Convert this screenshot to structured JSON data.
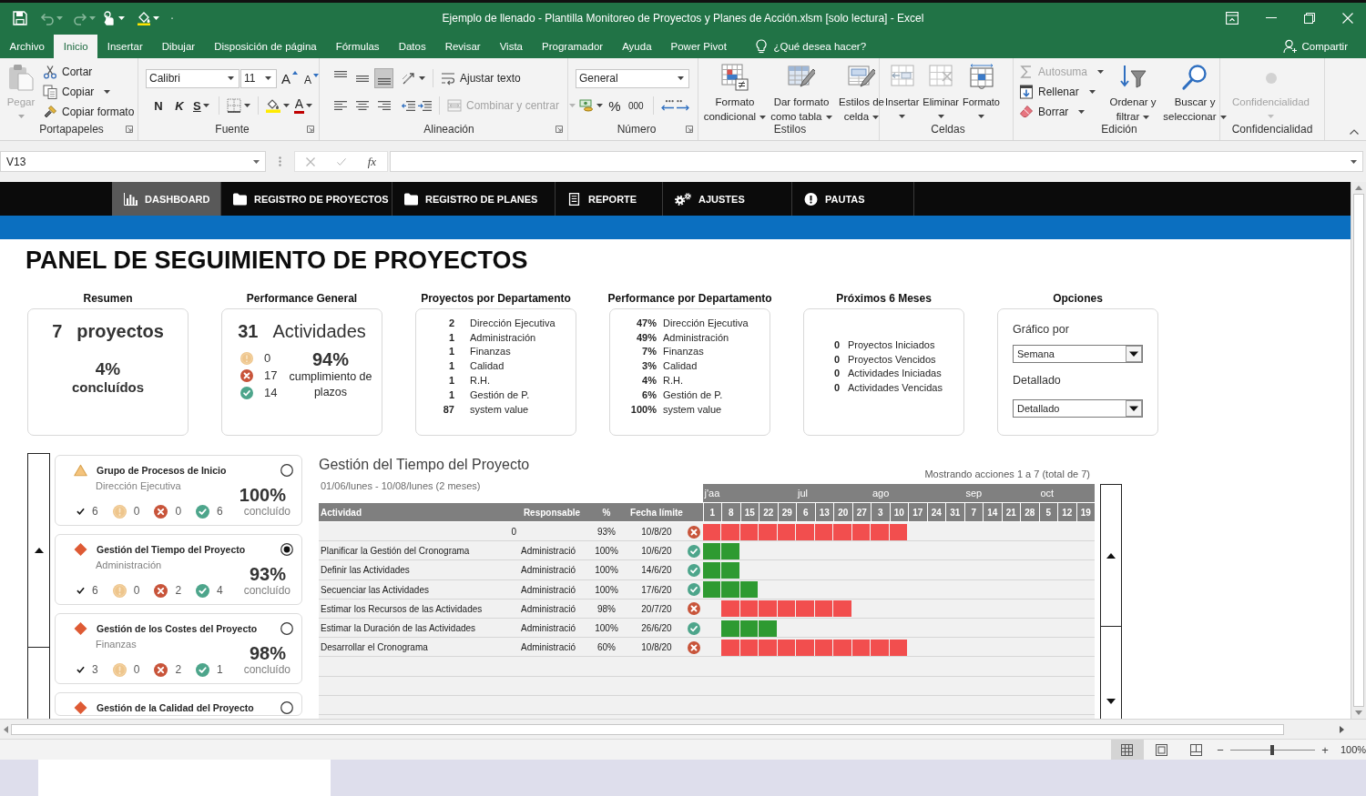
{
  "window": {
    "title": "Ejemplo de llenado - Plantilla Monitoreo de Proyectos y Planes de Acción.xlsm [solo lectura] - Excel"
  },
  "ribbon_tabs": [
    {
      "label": "Archivo",
      "selected": false
    },
    {
      "label": "Inicio",
      "selected": true
    },
    {
      "label": "Insertar",
      "selected": false
    },
    {
      "label": "Dibujar",
      "selected": false
    },
    {
      "label": "Disposición de página",
      "selected": false
    },
    {
      "label": "Fórmulas",
      "selected": false
    },
    {
      "label": "Datos",
      "selected": false
    },
    {
      "label": "Revisar",
      "selected": false
    },
    {
      "label": "Vista",
      "selected": false
    },
    {
      "label": "Programador",
      "selected": false
    },
    {
      "label": "Ayuda",
      "selected": false
    },
    {
      "label": "Power Pivot",
      "selected": false
    }
  ],
  "tell_me": {
    "placeholder": "¿Qué desea hacer?"
  },
  "share": "Compartir",
  "ribbon": {
    "clipboard": {
      "label": "Portapapeles",
      "paste": {
        "label": "Pegar",
        "disabled": true
      },
      "cut": "Cortar",
      "copy": "Copiar",
      "format_painter": "Copiar formato"
    },
    "font": {
      "label": "Fuente",
      "family": "Calibri",
      "size": "11",
      "grow": "A",
      "shrink": "A",
      "bold": "N",
      "italic": "K",
      "underline": "S",
      "font_color": "A"
    },
    "alignment": {
      "label": "Alineación",
      "vertical": [
        {
          "selected": false
        },
        {
          "selected": false
        },
        {
          "selected": true
        }
      ],
      "horizontal": [
        {
          "selected": false
        },
        {
          "selected": false
        },
        {
          "selected": false
        }
      ],
      "wrap": "Ajustar texto",
      "merge": {
        "label": "Combinar y centrar",
        "disabled": true
      }
    },
    "number": {
      "label": "Número",
      "format": "General",
      "percent": "%",
      "thousands": "000"
    },
    "styles": {
      "label": "Estilos",
      "buttons": [
        "Formato condicional",
        "Dar formato como tabla",
        "Estilos de celda"
      ]
    },
    "cells": {
      "label": "Celdas",
      "buttons": [
        "Insertar",
        "Eliminar",
        "Formato"
      ]
    },
    "editing": {
      "label": "Edición",
      "autosum": {
        "label": "Autosuma",
        "disabled": true
      },
      "fill": "Rellenar",
      "clear": "Borrar",
      "sort": "Ordenar y filtrar",
      "find": "Buscar y seleccionar"
    },
    "sensitivity": {
      "label": "Confidencialidad",
      "button": {
        "label": "Confidencialidad",
        "disabled": true
      }
    }
  },
  "formula_bar": {
    "name_box": "V13",
    "function": "fx"
  },
  "nav": [
    {
      "label": "DASHBOARD",
      "selected": true
    },
    {
      "label": "REGISTRO DE PROYECTOS",
      "selected": false
    },
    {
      "label": "REGISTRO DE PLANES",
      "selected": false
    },
    {
      "label": "REPORTE",
      "selected": false
    },
    {
      "label": "AJUSTES",
      "selected": false
    },
    {
      "label": "PAUTAS",
      "selected": false
    }
  ],
  "dashboard": {
    "title": "PANEL DE SEGUIMIENTO DE PROYECTOS",
    "summary": {
      "heading": "Resumen",
      "count": "7",
      "count_label": "proyectos",
      "percent": "4%",
      "percent_label": "concluídos"
    },
    "performance": {
      "heading": "Performance General",
      "count": "31",
      "count_label": "Actividades",
      "statuses": [
        {
          "kind": "pending",
          "value": "0"
        },
        {
          "kind": "overdue",
          "value": "17"
        },
        {
          "kind": "done",
          "value": "14"
        }
      ],
      "percent": "94%",
      "percent_label": "cumplimiento de plazos"
    },
    "projects_by_department": {
      "heading": "Proyectos por Departamento",
      "rows": [
        {
          "count": "2",
          "department": "Dirección Ejecutiva"
        },
        {
          "count": "1",
          "department": "Administración"
        },
        {
          "count": "1",
          "department": "Finanzas"
        },
        {
          "count": "1",
          "department": "Calidad"
        },
        {
          "count": "1",
          "department": "R.H."
        },
        {
          "count": "1",
          "department": "Gestión de P."
        },
        {
          "count": "87",
          "department": "system value"
        }
      ]
    },
    "performance_by_department": {
      "heading": "Performance por Departamento",
      "rows": [
        {
          "percent": "47%",
          "department": "Dirección Ejecutiva"
        },
        {
          "percent": "49%",
          "department": "Administración"
        },
        {
          "percent": "7%",
          "department": "Finanzas"
        },
        {
          "percent": "3%",
          "department": "Calidad"
        },
        {
          "percent": "4%",
          "department": "R.H."
        },
        {
          "percent": "6%",
          "department": "Gestión de P."
        },
        {
          "percent": "100%",
          "department": "system value"
        }
      ]
    },
    "next_months": {
      "heading": "Próximos 6 Meses",
      "rows": [
        {
          "count": "0",
          "metric": "Proyectos Iniciados"
        },
        {
          "count": "0",
          "metric": "Proyectos Vencidos"
        },
        {
          "count": "0",
          "metric": "Actividades Iniciadas"
        },
        {
          "count": "0",
          "metric": "Actividades Vencidas"
        }
      ]
    },
    "options": {
      "heading": "Opciones",
      "fields": [
        {
          "label": "Gráfico por",
          "value": "Semana"
        },
        {
          "label": "Detallado",
          "value": "Detallado"
        }
      ]
    }
  },
  "projects": [
    {
      "kind": "triangle",
      "title": "Grupo de Procesos de Inicio",
      "department": "Dirección Ejecutiva",
      "counts": [
        {
          "kind": "total",
          "value": "6"
        },
        {
          "kind": "pending",
          "value": "0"
        },
        {
          "kind": "overdue",
          "value": "0"
        },
        {
          "kind": "done",
          "value": "6"
        }
      ],
      "percent": "100%",
      "percent_label": "concluído",
      "selected": false
    },
    {
      "kind": "diamond",
      "title": "Gestión del Tiempo del Proyecto",
      "department": "Administración",
      "counts": [
        {
          "kind": "total",
          "value": "6"
        },
        {
          "kind": "pending",
          "value": "0"
        },
        {
          "kind": "overdue",
          "value": "2"
        },
        {
          "kind": "done",
          "value": "4"
        }
      ],
      "percent": "93%",
      "percent_label": "concluído",
      "selected": true
    },
    {
      "kind": "diamond",
      "title": "Gestión de los Costes del Proyecto",
      "department": "Finanzas",
      "counts": [
        {
          "kind": "total",
          "value": "3"
        },
        {
          "kind": "pending",
          "value": "0"
        },
        {
          "kind": "overdue",
          "value": "2"
        },
        {
          "kind": "done",
          "value": "1"
        }
      ],
      "percent": "98%",
      "percent_label": "concluído",
      "selected": false
    },
    {
      "kind": "diamond",
      "title": "Gestión de la Calidad del Proyecto",
      "selected": false
    }
  ],
  "gantt": {
    "title": "Gestión del Tiempo del Proyecto",
    "period": "01/06/lunes - 10/08/lunes (2 meses)",
    "showing": "Mostrando acciones 1 a 7 (total de 7)",
    "months": [
      {
        "label": "j'aa",
        "weeks": [
          "1",
          "8",
          "15",
          "22",
          "29"
        ]
      },
      {
        "label": "jul",
        "weeks": [
          "6",
          "13",
          "20",
          "27"
        ]
      },
      {
        "label": "ago",
        "weeks": [
          "3",
          "10",
          "17",
          "24",
          "31"
        ]
      },
      {
        "label": "sep",
        "weeks": [
          "7",
          "14",
          "21",
          "28"
        ]
      },
      {
        "label": "oct",
        "weeks": [
          "5",
          "12",
          "19"
        ]
      }
    ],
    "columns": [
      "Actividad",
      "Responsable",
      "%",
      "Fecha límite"
    ],
    "rows": [
      {
        "activity": "0",
        "percent": "93%",
        "due": "10/8/20",
        "kind": "overdue",
        "weeks": [
          true,
          true,
          true,
          true,
          true,
          true,
          true,
          true,
          true,
          true,
          true,
          false,
          false,
          false,
          false,
          false,
          false,
          false,
          false,
          false,
          false
        ]
      },
      {
        "activity": "Planificar la Gestión del Cronograma",
        "owner": "Administració",
        "percent": "100%",
        "due": "10/6/20",
        "kind": "done",
        "weeks": [
          true,
          true,
          false,
          false,
          false,
          false,
          false,
          false,
          false,
          false,
          false,
          false,
          false,
          false,
          false,
          false,
          false,
          false,
          false,
          false,
          false
        ]
      },
      {
        "activity": "Definir las Actividades",
        "owner": "Administració",
        "percent": "100%",
        "due": "14/6/20",
        "kind": "done",
        "weeks": [
          true,
          true,
          false,
          false,
          false,
          false,
          false,
          false,
          false,
          false,
          false,
          false,
          false,
          false,
          false,
          false,
          false,
          false,
          false,
          false,
          false
        ]
      },
      {
        "activity": "Secuenciar las Actividades",
        "owner": "Administració",
        "percent": "100%",
        "due": "17/6/20",
        "kind": "done",
        "weeks": [
          true,
          true,
          true,
          false,
          false,
          false,
          false,
          false,
          false,
          false,
          false,
          false,
          false,
          false,
          false,
          false,
          false,
          false,
          false,
          false,
          false
        ]
      },
      {
        "activity": "Estimar los Recursos de las Actividades",
        "owner": "Administració",
        "percent": "98%",
        "due": "20/7/20",
        "kind": "overdue",
        "weeks": [
          false,
          true,
          true,
          true,
          true,
          true,
          true,
          true,
          false,
          false,
          false,
          false,
          false,
          false,
          false,
          false,
          false,
          false,
          false,
          false,
          false
        ]
      },
      {
        "activity": "Estimar la Duración de las Actividades",
        "owner": "Administració",
        "percent": "100%",
        "due": "26/6/20",
        "kind": "done",
        "weeks": [
          false,
          true,
          true,
          true,
          false,
          false,
          false,
          false,
          false,
          false,
          false,
          false,
          false,
          false,
          false,
          false,
          false,
          false,
          false,
          false,
          false
        ]
      },
      {
        "activity": "Desarrollar el Cronograma",
        "owner": "Administració",
        "percent": "60%",
        "due": "10/8/20",
        "kind": "overdue",
        "weeks": [
          false,
          true,
          true,
          true,
          true,
          true,
          true,
          true,
          true,
          true,
          true,
          false,
          false,
          false,
          false,
          false,
          false,
          false,
          false,
          false,
          false
        ]
      }
    ]
  },
  "status_bar": {
    "views": [
      {
        "selected": true
      },
      {
        "selected": false
      },
      {
        "selected": false
      }
    ],
    "zoom": {
      "out": "−",
      "in": "+",
      "level": 0.5,
      "label": "100%"
    }
  }
}
